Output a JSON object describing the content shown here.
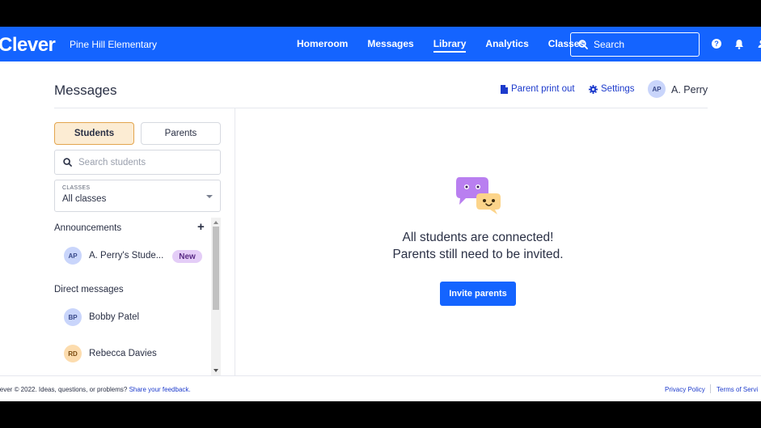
{
  "nav": {
    "logo": "Clever",
    "school": "Pine Hill Elementary",
    "links": [
      {
        "label": "Homeroom",
        "active": false
      },
      {
        "label": "Messages",
        "active": false
      },
      {
        "label": "Library",
        "active": true
      },
      {
        "label": "Analytics",
        "active": false
      },
      {
        "label": "Classes",
        "active": false
      }
    ],
    "search_placeholder": "Search",
    "icons": [
      "help-icon",
      "bell-icon",
      "profile-icon"
    ]
  },
  "header": {
    "title": "Messages",
    "print_label": "Parent print out",
    "settings_label": "Settings",
    "user_initials": "AP",
    "user_name": "A. Perry"
  },
  "sidebar": {
    "tab_students": "Students",
    "tab_parents": "Parents",
    "search_placeholder": "Search students",
    "classes_label": "CLASSES",
    "classes_value": "All classes",
    "announcements_title": "Announcements",
    "announcement": {
      "initials": "AP",
      "name": "A. Perry's Stude...",
      "badge": "New"
    },
    "direct_title": "Direct messages",
    "direct": [
      {
        "initials": "BP",
        "name": "Bobby Patel"
      },
      {
        "initials": "RD",
        "name": "Rebecca Davies"
      }
    ]
  },
  "main": {
    "line1": "All students are connected!",
    "line2": "Parents still need to be invited.",
    "invite_label": "Invite parents"
  },
  "footer": {
    "copyright": "lever © 2022. Ideas, questions, or problems?",
    "feedback": "Share your feedback.",
    "privacy": "Privacy Policy",
    "terms": "Terms of Servi"
  },
  "colors": {
    "brand": "#1464ff",
    "link": "#1d3bcc",
    "tab_active_bg": "#fcecd3",
    "badge_bg": "#e4cdf7",
    "avatar_blue": "#c9d5fb",
    "avatar_orange": "#fcdcae"
  }
}
